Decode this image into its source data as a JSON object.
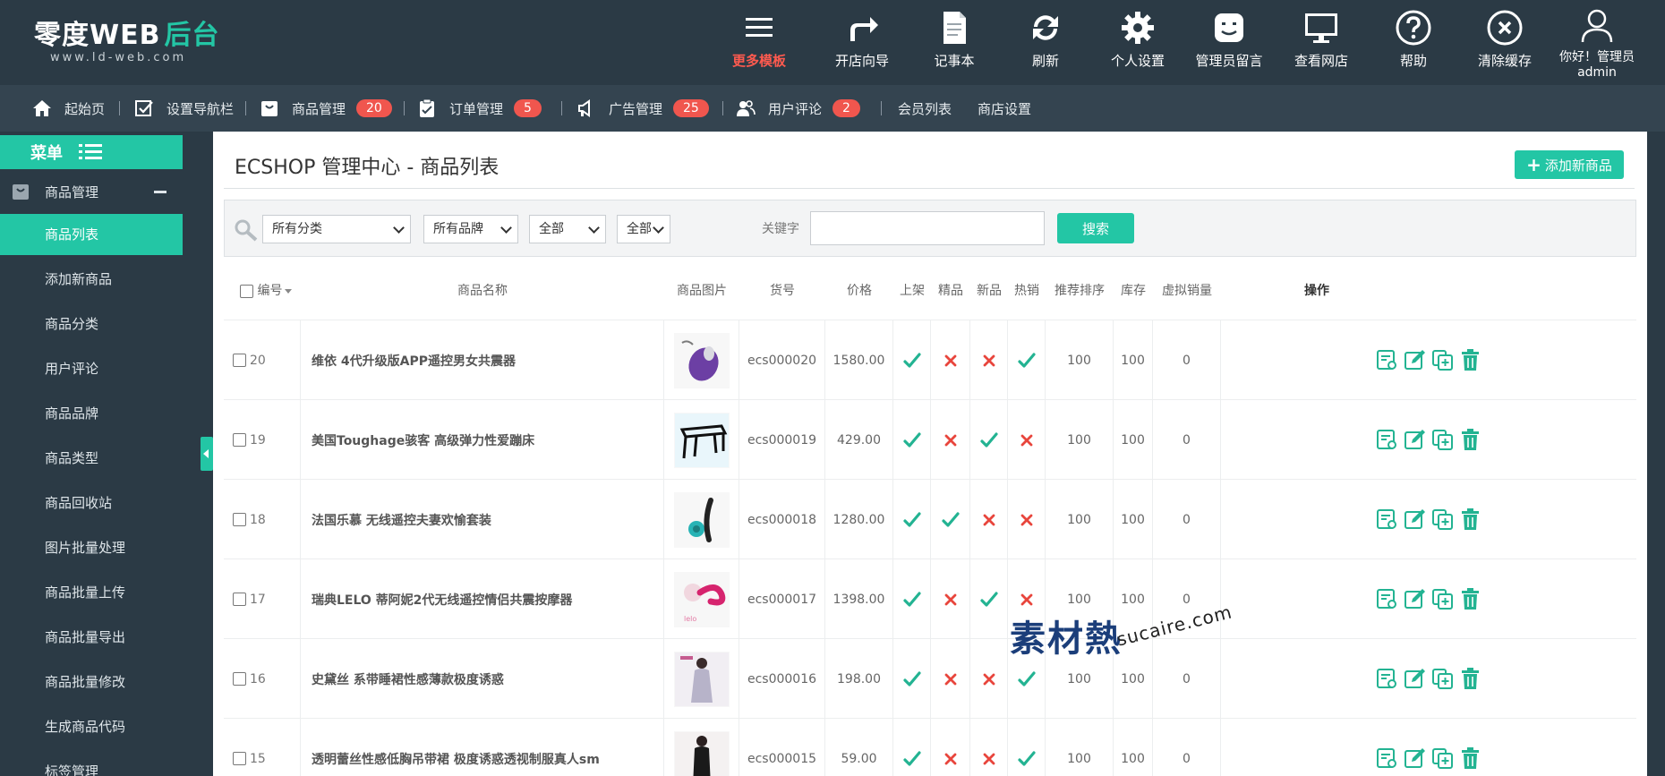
{
  "logo": {
    "main": "零度WEB",
    "accent": "后台",
    "sub": "www.ld-web.com"
  },
  "topbar": [
    {
      "label": "更多模板",
      "icon": "menu-icon",
      "hot": true
    },
    {
      "label": "开店向导",
      "icon": "redo-arrow-icon"
    },
    {
      "label": "记事本",
      "icon": "notepad-icon"
    },
    {
      "label": "刷新",
      "icon": "refresh-icon"
    },
    {
      "label": "个人设置",
      "icon": "gear-icon"
    },
    {
      "label": "管理员留言",
      "icon": "message-face-icon"
    },
    {
      "label": "查看网店",
      "icon": "monitor-icon"
    },
    {
      "label": "帮助",
      "icon": "help-icon"
    },
    {
      "label": "清除缓存",
      "icon": "clear-icon"
    },
    {
      "label": "你好！管理员",
      "label2": "admin",
      "icon": "user-icon"
    }
  ],
  "nav": [
    {
      "label": "起始页",
      "icon": "home-icon"
    },
    {
      "label": "设置导航栏",
      "icon": "checkbox-icon"
    },
    {
      "label": "商品管理",
      "icon": "bag-icon",
      "badge": "20"
    },
    {
      "label": "订单管理",
      "icon": "clipboard-icon",
      "badge": "5"
    },
    {
      "label": "广告管理",
      "icon": "speaker-icon",
      "badge": "25"
    },
    {
      "label": "用户评论",
      "icon": "users-icon",
      "badge": "2"
    },
    {
      "label": "会员列表"
    },
    {
      "label": "商店设置"
    }
  ],
  "sidebar": {
    "menu_title": "菜单",
    "group": "商品管理",
    "items": [
      {
        "label": "商品列表",
        "active": true
      },
      {
        "label": "添加新商品"
      },
      {
        "label": "商品分类"
      },
      {
        "label": "用户评论"
      },
      {
        "label": "商品品牌"
      },
      {
        "label": "商品类型"
      },
      {
        "label": "商品回收站"
      },
      {
        "label": "图片批量处理"
      },
      {
        "label": "商品批量上传"
      },
      {
        "label": "商品批量导出"
      },
      {
        "label": "商品批量修改"
      },
      {
        "label": "生成商品代码"
      },
      {
        "label": "标签管理"
      }
    ]
  },
  "page": {
    "title": "ECSHOP 管理中心 - 商品列表",
    "add_button": "添加新商品"
  },
  "filter": {
    "category": "所有分类",
    "brand": "所有品牌",
    "type1": "全部",
    "type2": "全部",
    "keyword_label": "关键字",
    "keyword_value": "",
    "search_button": "搜索"
  },
  "table": {
    "headers": {
      "id": "编号",
      "name": "商品名称",
      "image": "商品图片",
      "sn": "货号",
      "price": "价格",
      "on_sale": "上架",
      "best": "精品",
      "new": "新品",
      "hot": "热销",
      "sort": "推荐排序",
      "stock": "库存",
      "virtual_sales": "虚拟销量",
      "ops": "操作"
    },
    "rows": [
      {
        "id": "20",
        "name": "维依 4代升级版APP遥控男女共震器",
        "sn": "ecs000020",
        "price": "1580.00",
        "on_sale": true,
        "best": false,
        "new": false,
        "hot": true,
        "sort": "100",
        "stock": "100",
        "virtual_sales": "0",
        "thumb": "purple-device"
      },
      {
        "id": "19",
        "name": "美国Toughage骇客 高级弹力性爱蹦床",
        "sn": "ecs000019",
        "price": "429.00",
        "on_sale": true,
        "best": false,
        "new": true,
        "hot": false,
        "sort": "100",
        "stock": "100",
        "virtual_sales": "0",
        "thumb": "black-stool"
      },
      {
        "id": "18",
        "name": "法国乐慕 无线遥控夫妻欢愉套装",
        "sn": "ecs000018",
        "price": "1280.00",
        "on_sale": true,
        "best": true,
        "new": false,
        "hot": false,
        "sort": "100",
        "stock": "100",
        "virtual_sales": "0",
        "thumb": "teal-set"
      },
      {
        "id": "17",
        "name": "瑞典LELO 蒂阿妮2代无线遥控情侣共震按摩器",
        "sn": "ecs000017",
        "price": "1398.00",
        "on_sale": true,
        "best": false,
        "new": true,
        "hot": false,
        "sort": "100",
        "stock": "100",
        "virtual_sales": "0",
        "thumb": "pink-device"
      },
      {
        "id": "16",
        "name": "史黛丝 系带睡裙性感薄款极度诱惑",
        "sn": "ecs000016",
        "price": "198.00",
        "on_sale": true,
        "best": false,
        "new": false,
        "hot": true,
        "sort": "100",
        "stock": "100",
        "virtual_sales": "0",
        "thumb": "lingerie-model"
      },
      {
        "id": "15",
        "name": "透明蕾丝性感低胸吊带裙 极度诱惑透视制服真人sm",
        "sn": "ecs000015",
        "price": "59.00",
        "on_sale": true,
        "best": false,
        "new": false,
        "hot": true,
        "sort": "100",
        "stock": "100",
        "virtual_sales": "0",
        "thumb": "black-lace-model"
      }
    ]
  },
  "watermark": {
    "cn": "素材熱",
    "en": "sucaire.com"
  },
  "colors": {
    "accent": "#23c6a5",
    "dark": "#2b3a45",
    "danger": "#e8453c",
    "badge": "#f0564e"
  }
}
